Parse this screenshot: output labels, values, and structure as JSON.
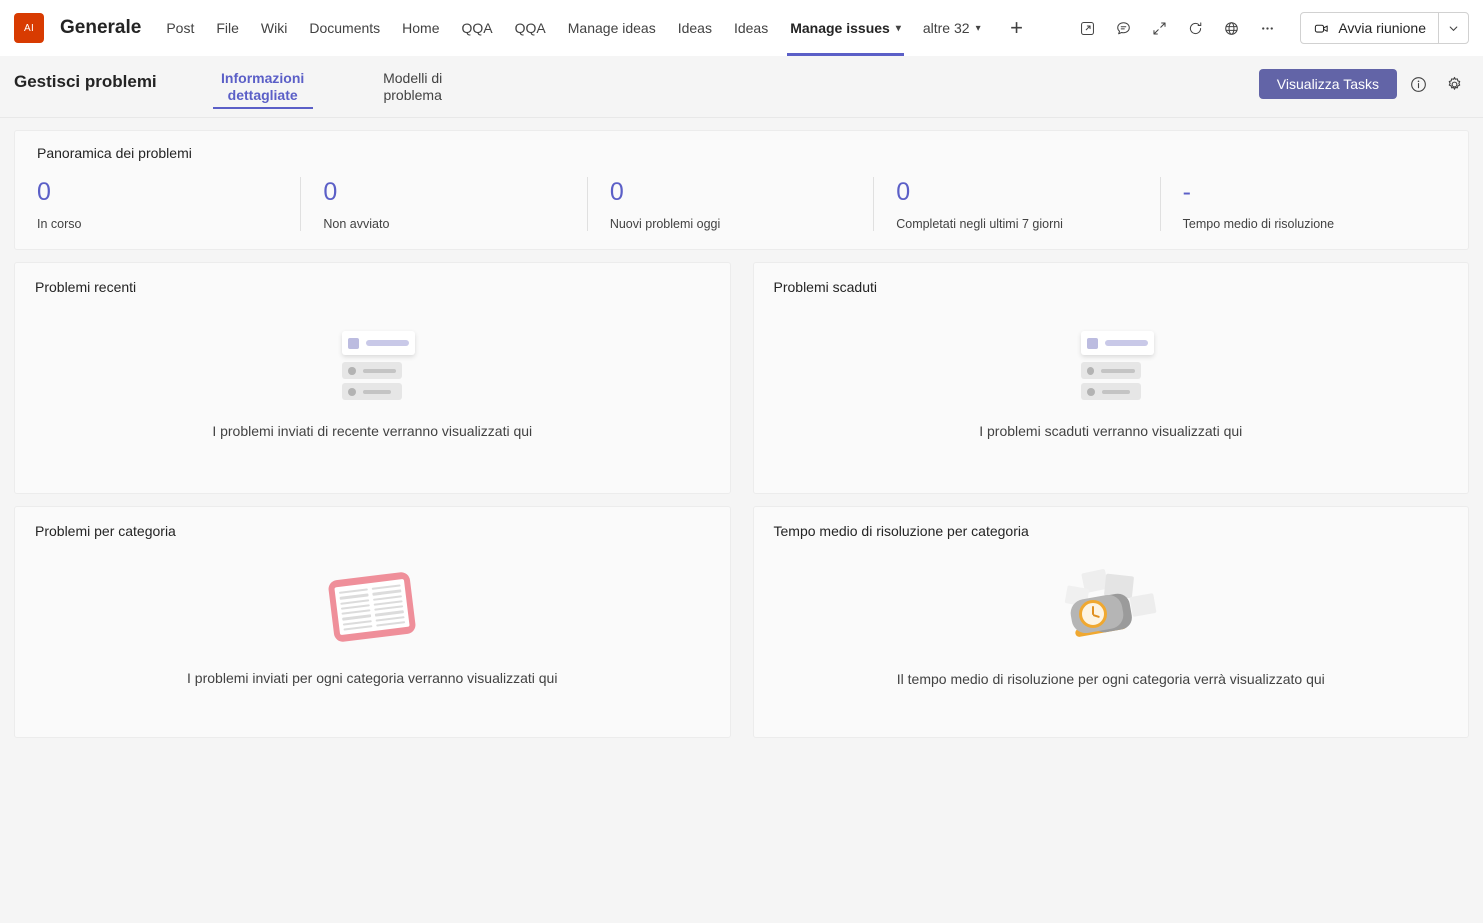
{
  "topbar": {
    "app_icon_label": "AI",
    "channel_title": "Generale",
    "tabs": [
      {
        "label": "Post",
        "active": false,
        "chevron": false
      },
      {
        "label": "File",
        "active": false,
        "chevron": false
      },
      {
        "label": "Wiki",
        "active": false,
        "chevron": false
      },
      {
        "label": "Documents",
        "active": false,
        "chevron": false
      },
      {
        "label": "Home",
        "active": false,
        "chevron": false
      },
      {
        "label": "QQA",
        "active": false,
        "chevron": false
      },
      {
        "label": "QQA",
        "active": false,
        "chevron": false
      },
      {
        "label": "Manage ideas",
        "active": false,
        "chevron": false
      },
      {
        "label": "Ideas",
        "active": false,
        "chevron": false
      },
      {
        "label": "Ideas",
        "active": false,
        "chevron": false
      },
      {
        "label": "Manage issues",
        "active": true,
        "chevron": true
      },
      {
        "label": "altre 32",
        "active": false,
        "chevron": true
      }
    ],
    "add_tab_label": "+",
    "meeting_button_label": "Avvia riunione",
    "icons": [
      "popout-icon",
      "chat-icon",
      "expand-icon",
      "refresh-icon",
      "globe-icon",
      "more-options-icon"
    ]
  },
  "subheader": {
    "page_title": "Gestisci problemi",
    "tabs": [
      {
        "label": "Informazioni dettagliate",
        "active": true
      },
      {
        "label": "Modelli di problema",
        "active": false
      }
    ],
    "primary_button": "Visualizza Tasks",
    "info_icon": "info-icon",
    "settings_icon": "gear-icon"
  },
  "overview": {
    "title": "Panoramica dei problemi",
    "accent_color": "#5b5fc7",
    "stats": [
      {
        "value": "0",
        "label": "In corso"
      },
      {
        "value": "0",
        "label": "Non avviato"
      },
      {
        "value": "0",
        "label": "Nuovi problemi oggi"
      },
      {
        "value": "0",
        "label": "Completati negli ultimi 7 giorni"
      },
      {
        "value": "-",
        "label": "Tempo medio di risoluzione"
      }
    ]
  },
  "panels": [
    {
      "title": "Problemi recenti",
      "empty_text": "I problemi inviati di recente verranno visualizzati qui",
      "illustration": "list-placeholder-illustration"
    },
    {
      "title": "Problemi scaduti",
      "empty_text": "I problemi scaduti verranno visualizzati qui",
      "illustration": "list-placeholder-illustration"
    },
    {
      "title": "Problemi per categoria",
      "empty_text": "I problemi inviati per ogni categoria verranno visualizzati qui",
      "illustration": "book-illustration"
    },
    {
      "title": "Tempo medio di risoluzione per categoria",
      "empty_text": "Il tempo medio di risoluzione per ogni categoria verrà visualizzato qui",
      "illustration": "clock-illustration"
    }
  ]
}
